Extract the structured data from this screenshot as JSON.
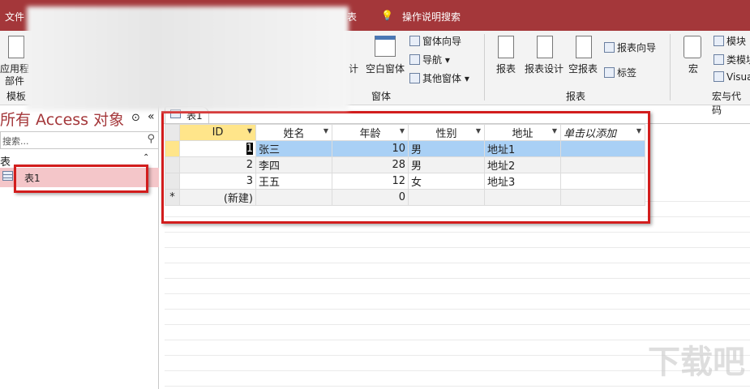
{
  "titlebar": {
    "file_tab": "文件",
    "table_tab_partial": "表",
    "tell_me": "操作说明搜索"
  },
  "ribbon": {
    "app_parts": [
      "应用程",
      "部件"
    ],
    "templates_group": "模板",
    "form_design_partial": "计",
    "blank_form": "空白窗体",
    "form_wizard": "窗体向导",
    "navigation": "导航",
    "more_forms": "其他窗体",
    "forms_group": "窗体",
    "report": "报表",
    "report_design": "报表设计",
    "blank_report": "空报表",
    "report_wizard": "报表向导",
    "labels": "标签",
    "reports_group": "报表",
    "macro": "宏",
    "module": "模块",
    "class_module": "类模块",
    "visual_basic": "Visua",
    "macros_group": "宏与代码"
  },
  "nav": {
    "title": "所有 Access 对象",
    "search_placeholder": "搜索...",
    "section": "表",
    "items": [
      {
        "label": "表1"
      }
    ]
  },
  "document_tab": "表1",
  "datasheet": {
    "columns": [
      "ID",
      "姓名",
      "年龄",
      "性别",
      "地址",
      "单击以添加"
    ],
    "rows": [
      {
        "id": "1",
        "name": "张三",
        "age": "10",
        "gender": "男",
        "address": "地址1"
      },
      {
        "id": "2",
        "name": "李四",
        "age": "28",
        "gender": "男",
        "address": "地址2"
      },
      {
        "id": "3",
        "name": "王五",
        "age": "12",
        "gender": "女",
        "address": "地址3"
      }
    ],
    "new_row": {
      "marker": "*",
      "id": "(新建)",
      "age": "0"
    }
  },
  "watermark": "下载吧"
}
